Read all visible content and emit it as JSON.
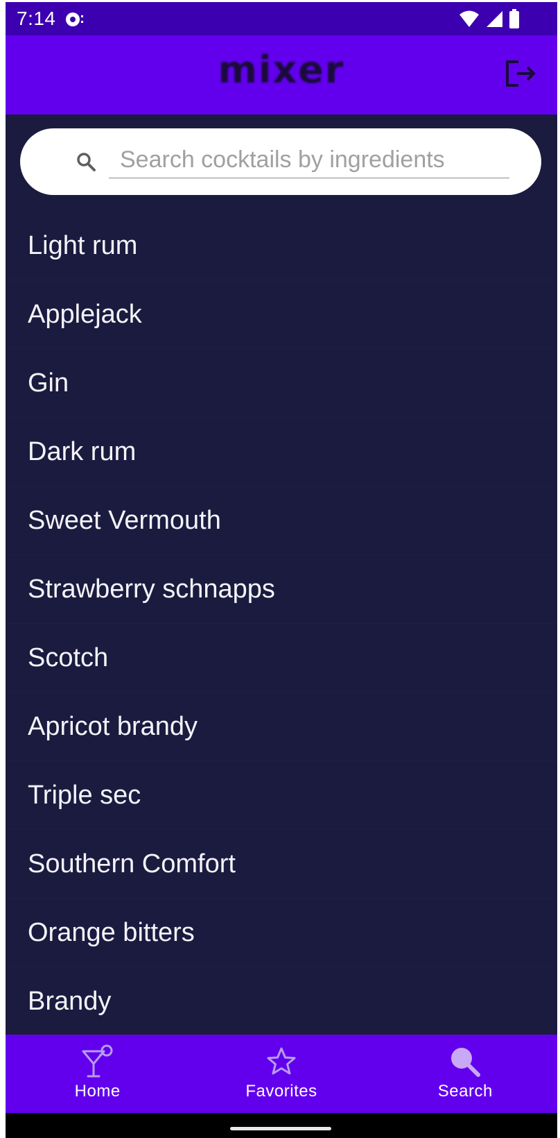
{
  "status_bar": {
    "time": "7:14"
  },
  "app_bar": {
    "title": "mixer"
  },
  "search": {
    "placeholder": "Search cocktails by ingredients",
    "value": ""
  },
  "ingredients": [
    "Light rum",
    "Applejack",
    "Gin",
    "Dark rum",
    "Sweet Vermouth",
    "Strawberry schnapps",
    "Scotch",
    "Apricot brandy",
    "Triple sec",
    "Southern Comfort",
    "Orange bitters",
    "Brandy"
  ],
  "bottom_nav": {
    "home": {
      "label": "Home",
      "icon": "cocktail-glass-icon"
    },
    "favorites": {
      "label": "Favorites",
      "icon": "star-outline-icon"
    },
    "search": {
      "label": "Search",
      "icon": "search-icon",
      "selected": true
    }
  },
  "colors": {
    "primary": "#6200ee",
    "status_bar": "#3d00b0",
    "background": "#1b1b40",
    "search_active": "#c9a8f5"
  }
}
